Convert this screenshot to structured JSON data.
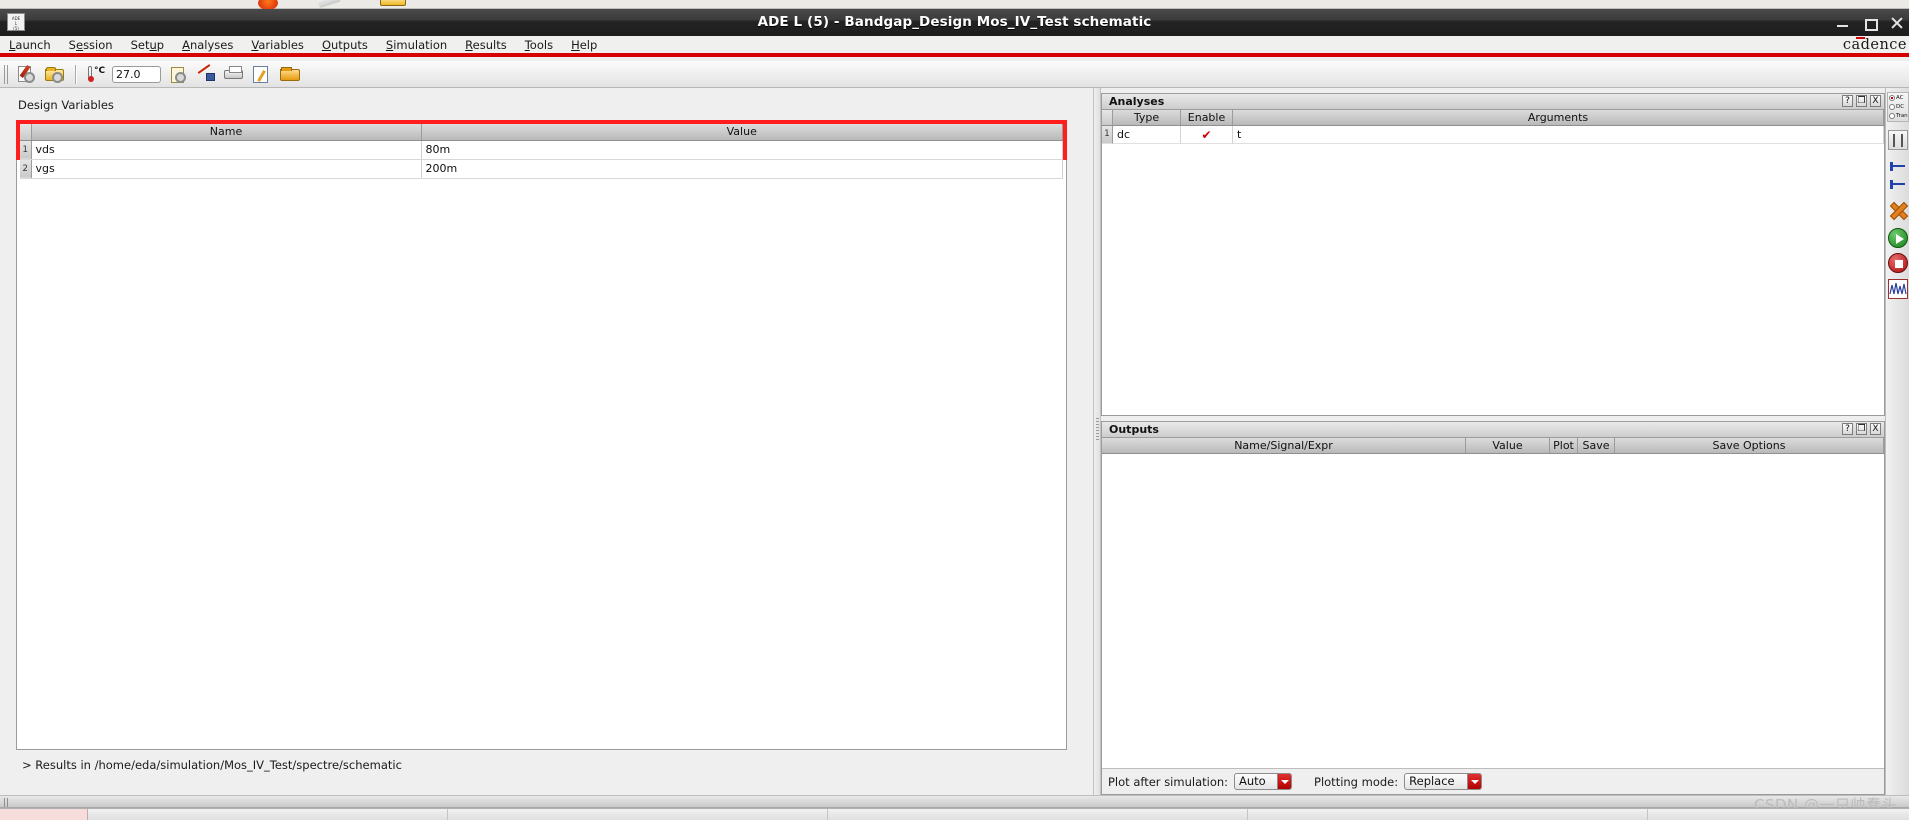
{
  "window": {
    "title": "ADE L (5) - Bandgap_Design Mos_IV_Test schematic",
    "app_icon_text": "ADE L (5)",
    "minimize": "–",
    "maximize": "□",
    "close": "✕"
  },
  "menubar": {
    "items": [
      {
        "label": "Launch",
        "accel": "L"
      },
      {
        "label": "Session",
        "accel": "e"
      },
      {
        "label": "Setup",
        "accel": "u"
      },
      {
        "label": "Analyses",
        "accel": "A"
      },
      {
        "label": "Variables",
        "accel": "V"
      },
      {
        "label": "Outputs",
        "accel": "O"
      },
      {
        "label": "Simulation",
        "accel": "S"
      },
      {
        "label": "Results",
        "accel": "R"
      },
      {
        "label": "Tools",
        "accel": "T"
      },
      {
        "label": "Help",
        "accel": "H"
      }
    ],
    "brand": "cadence"
  },
  "toolbar": {
    "temperature_value": "27.0",
    "buttons": [
      {
        "name": "save-state-icon"
      },
      {
        "name": "open-folder-icon"
      },
      {
        "name": "design-temperature-icon"
      },
      {
        "name": "setup-simulator-icon"
      },
      {
        "name": "netlist-probe-icon"
      },
      {
        "name": "netlist-output-icon"
      },
      {
        "name": "edit-variables-icon"
      },
      {
        "name": "open-results-folder-icon"
      }
    ]
  },
  "design_variables": {
    "section_label": "Design Variables",
    "columns": [
      "Name",
      "Value"
    ],
    "rows": [
      {
        "num": "1",
        "name": "vds",
        "value": "80m"
      },
      {
        "num": "2",
        "name": "vgs",
        "value": "200m"
      }
    ]
  },
  "log": {
    "line": "> Results in /home/eda/simulation/Mos_IV_Test/spectre/schematic"
  },
  "analyses": {
    "title": "Analyses",
    "help_btn": "?",
    "float_btn": "❐",
    "close_btn": "X",
    "columns": [
      "Type",
      "Enable",
      "Arguments"
    ],
    "rows": [
      {
        "num": "1",
        "type": "dc",
        "enable": true,
        "arguments": "t"
      }
    ]
  },
  "outputs": {
    "title": "Outputs",
    "help_btn": "?",
    "float_btn": "❐",
    "close_btn": "X",
    "columns": [
      "Name/Signal/Expr",
      "Value",
      "Plot",
      "Save",
      "Save Options"
    ],
    "rows": [],
    "plot_after_simulation_label": "Plot after simulation:",
    "plot_after_simulation_value": "Auto",
    "plotting_mode_label": "Plotting mode:",
    "plotting_mode_value": "Replace"
  },
  "rail": {
    "radios": [
      {
        "label": "AC",
        "selected": true
      },
      {
        "label": "DC",
        "selected": false
      },
      {
        "label": "Tran",
        "selected": false
      }
    ],
    "icons": [
      {
        "name": "choose-analyses-icon"
      },
      {
        "name": "edit-variables-rail-icon"
      },
      {
        "name": "setup-outputs-rail-icon"
      },
      {
        "name": "delete-icon"
      },
      {
        "name": "run-simulation-icon"
      },
      {
        "name": "stop-simulation-icon"
      },
      {
        "name": "plot-outputs-icon"
      }
    ]
  },
  "watermark": {
    "text": "CSDN @一只帅蠢头"
  },
  "taskbar": {
    "start_label": "",
    "tasks": [
      "",
      "",
      "",
      ""
    ]
  },
  "colors": {
    "accent_red": "#d60000",
    "highlight_red": "#ff1d1d",
    "titlebar_dark": "#242424",
    "panel_grey": "#efefef"
  }
}
